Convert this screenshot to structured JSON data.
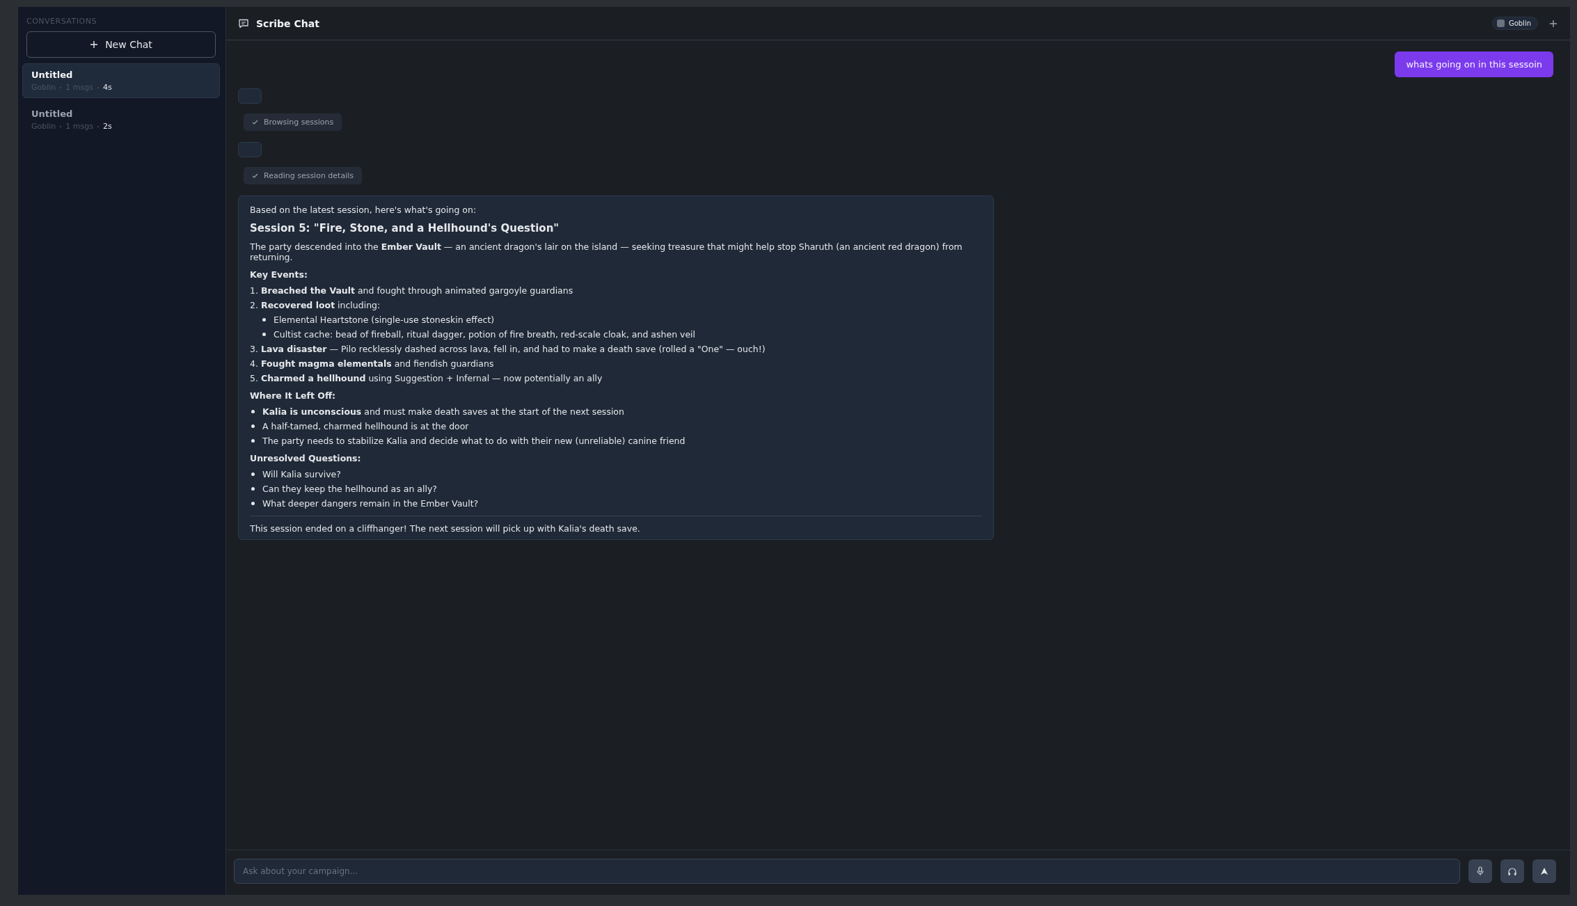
{
  "sidebar": {
    "heading": "CONVERSATIONS",
    "new_chat_label": "New Chat",
    "conversations": [
      {
        "title": "Untitled",
        "persona": "Goblin",
        "count": "1 msgs",
        "age": "4s",
        "selected": true
      },
      {
        "title": "Untitled",
        "persona": "Goblin",
        "count": "1 msgs",
        "age": "2s",
        "selected": false
      }
    ]
  },
  "header": {
    "title": "Scribe Chat",
    "persona": "Goblin"
  },
  "messages": [
    {
      "kind": "user",
      "text": "whats going on in this sessoin"
    },
    {
      "kind": "pending"
    },
    {
      "kind": "tool",
      "text": "Browsing sessions"
    },
    {
      "kind": "pending"
    },
    {
      "kind": "tool",
      "text": "Reading session details"
    },
    {
      "kind": "answer",
      "blocks": [
        {
          "kind": "paragraph",
          "text": "Based on the latest session, here's what's going on:"
        },
        {
          "kind": "heading",
          "text": "Session 5: \"Fire, Stone, and a Hellhound's Question\""
        },
        {
          "kind": "paragraph",
          "text": "The party descended into the **Ember Vault** — an ancient dragon's lair on the island — seeking treasure that might help stop Sharuth (an ancient red dragon) from returning."
        },
        {
          "kind": "subheading",
          "text": "Key Events:"
        },
        {
          "kind": "ordered",
          "items": [
            {
              "marker": "1.",
              "text": "**Breached the Vault** and fought through animated gargoyle guardians"
            },
            {
              "marker": "2.",
              "text": "**Recovered loot** including:",
              "children": [
                "Elemental Heartstone (single-use stoneskin effect)",
                "Cultist cache: bead of fireball, ritual dagger, potion of fire breath, red-scale cloak, and ashen veil"
              ]
            },
            {
              "marker": "3.",
              "text": "**Lava disaster** — Pilo recklessly dashed across lava, fell in, and had to make a death save (rolled a \"One\" — ouch!)"
            },
            {
              "marker": "4.",
              "text": "**Fought magma elementals** and fiendish guardians"
            },
            {
              "marker": "5.",
              "text": "**Charmed a hellhound** using Suggestion + Infernal — now potentially an ally"
            }
          ]
        },
        {
          "kind": "subheading",
          "text": "Where It Left Off:"
        },
        {
          "kind": "bullets",
          "items": [
            "**Kalia is unconscious** and must make death saves at the start of the next session",
            "A half-tamed, charmed hellhound is at the door",
            "The party needs to stabilize Kalia and decide what to do with their new (unreliable) canine friend"
          ]
        },
        {
          "kind": "subheading",
          "text": "Unresolved Questions:"
        },
        {
          "kind": "bullets",
          "items": [
            "Will Kalia survive?",
            "Can they keep the hellhound as an ally?",
            "What deeper dangers remain in the Ember Vault?"
          ]
        },
        {
          "kind": "footer",
          "text": "This session ended on a cliffhanger! The next session will pick up with Kalia's death save."
        }
      ]
    }
  ],
  "composer": {
    "placeholder": "Ask about your campaign..."
  }
}
